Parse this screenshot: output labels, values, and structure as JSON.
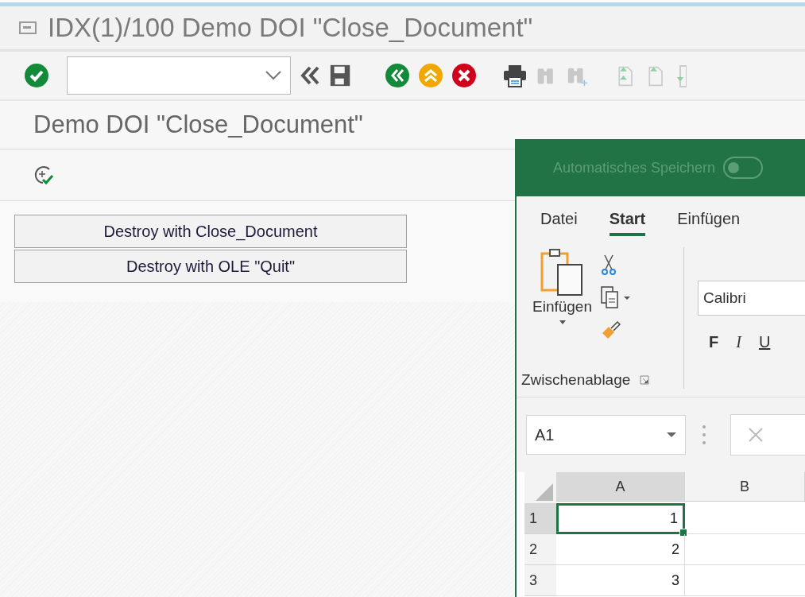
{
  "window": {
    "title": "IDX(1)/100 Demo DOI \"Close_Document\""
  },
  "screen": {
    "title": "Demo DOI \"Close_Document\"",
    "buttons": [
      "Destroy with Close_Document",
      "Destroy with OLE \"Quit\""
    ]
  },
  "excel": {
    "autosave": {
      "label": "Automatisches Speichern",
      "on": false
    },
    "tabs": [
      {
        "label": "Datei",
        "selected": false
      },
      {
        "label": "Start",
        "selected": true
      },
      {
        "label": "Einfügen",
        "selected": false
      }
    ],
    "clipboard": {
      "paste_label": "Einfügen",
      "group_label": "Zwischenablage"
    },
    "font": {
      "name": "Calibri"
    },
    "format_buttons": [
      "F",
      "I",
      "U"
    ],
    "name_box": "A1",
    "columns": [
      {
        "label": "A",
        "selected": true
      },
      {
        "label": "B",
        "selected": false
      }
    ],
    "rows": [
      {
        "header": "1",
        "cells": [
          "1"
        ],
        "selected": true
      },
      {
        "header": "2",
        "cells": [
          "2"
        ],
        "selected": false
      },
      {
        "header": "3",
        "cells": [
          "3"
        ],
        "selected": false
      }
    ]
  }
}
